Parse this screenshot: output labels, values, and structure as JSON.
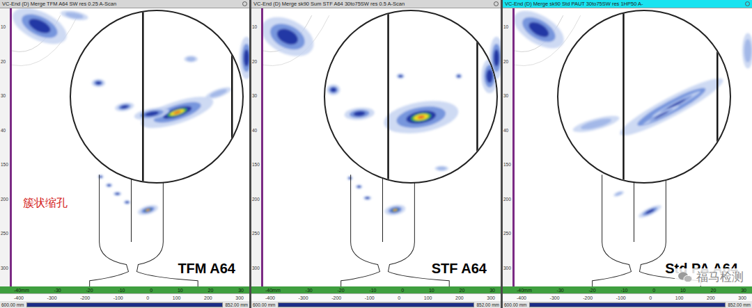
{
  "panels": [
    {
      "title": "VC-End (D) Merge TFM A64 SW res 0.25 A-Scan",
      "selected": false,
      "label": "TFM A64",
      "depth_ticks": [
        "10",
        "20",
        "30",
        "40",
        "150",
        "200",
        "250",
        "300"
      ],
      "axis_mm": [
        "-40mm",
        "-30",
        "-20",
        "-10",
        "0",
        "10",
        "20",
        "30"
      ],
      "axis_index": [
        "-400",
        "-300",
        "-200",
        "-100",
        "0",
        "100",
        "200",
        "300"
      ],
      "scroll_start": "600.00 mm",
      "scroll_end": "852.00 mm"
    },
    {
      "title": "VC-End (D) Merge sk90 Sum STF A64 30to75SW res 0.5 A-Scan",
      "selected": false,
      "label": "STF A64",
      "depth_ticks": [
        "10",
        "20",
        "30",
        "40",
        "150",
        "200",
        "250",
        "300"
      ],
      "axis_mm": [
        "-40mm",
        "-30",
        "-20",
        "-10",
        "0",
        "10",
        "20",
        "30"
      ],
      "axis_index": [
        "-400",
        "-300",
        "-200",
        "-100",
        "0",
        "100",
        "200",
        "300"
      ],
      "scroll_start": "600.00 mm",
      "scroll_end": "852.00 mm"
    },
    {
      "title": "VC-End (D) Merge sk90 Std PAUT 30to75SW res 1HP50 A-",
      "selected": true,
      "label": "Std PA A64",
      "depth_ticks": [
        "10",
        "20",
        "30",
        "40",
        "150",
        "200",
        "250",
        "300"
      ],
      "axis_mm": [
        "-40mm",
        "-30",
        "-20",
        "-10",
        "0",
        "10",
        "20",
        "30"
      ],
      "axis_index": [
        "-400",
        "-300",
        "-200",
        "-100",
        "0",
        "100",
        "200",
        "300"
      ],
      "scroll_start": "600.00 mm",
      "scroll_end": "852.00 mm"
    }
  ],
  "annotation": "簇状缩孔",
  "watermark": "福马检测"
}
